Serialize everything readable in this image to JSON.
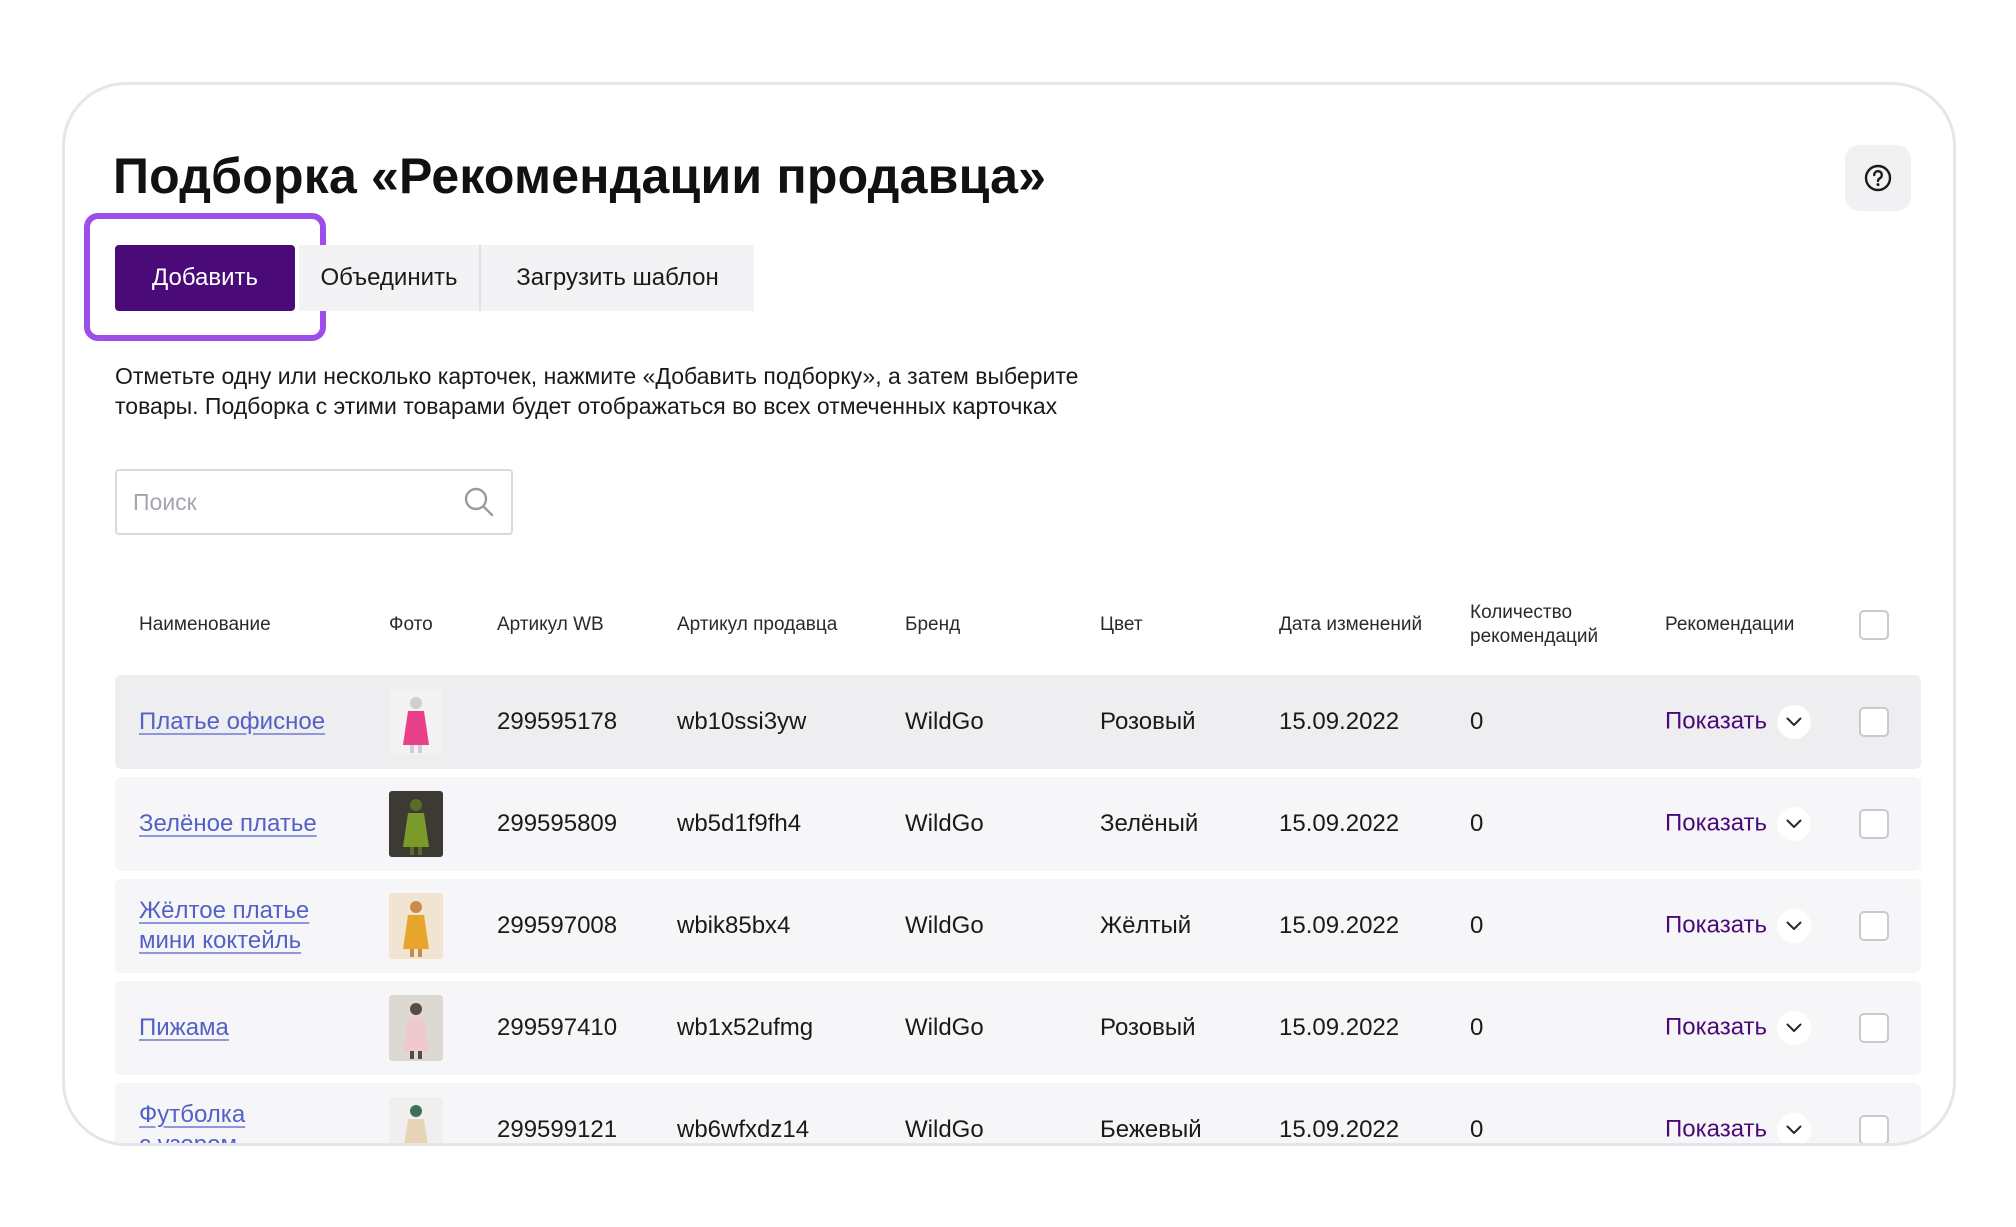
{
  "page": {
    "title": "Подборка «Рекомендации продавца»",
    "help_icon": "question-circle-icon"
  },
  "toolbar": {
    "add_label": "Добавить",
    "merge_label": "Объединить",
    "template_label": "Загрузить шаблон"
  },
  "description": {
    "line1": "Отметьте одну или несколько карточек, нажмите «Добавить подборку», а затем выберите",
    "line2": "товары. Подборка с этими товарами будет отображаться во всех отмеченных карточках"
  },
  "search": {
    "placeholder": "Поиск",
    "icon": "search-icon"
  },
  "table": {
    "columns": {
      "name": "Наименование",
      "photo": "Фото",
      "article_wb": "Артикул WB",
      "article_seller": "Артикул продавца",
      "brand": "Бренд",
      "color": "Цвет",
      "date": "Дата изменений",
      "count_line1": "Количество",
      "count_line2": "рекомендаций",
      "recommendations": "Рекомендации"
    },
    "rows": [
      {
        "name_line1": "Платье офисное",
        "name_line2": "",
        "article_wb": "299595178",
        "article_seller": "wb10ssi3yw",
        "brand": "WildGo",
        "color": "Розовый",
        "date": "15.09.2022",
        "count": "0",
        "action": "Показать",
        "photo_colors": [
          "#f2f2f2",
          "#e8418a",
          "#cfcfcf"
        ]
      },
      {
        "name_line1": "Зелёное платье",
        "name_line2": "",
        "article_wb": "299595809",
        "article_seller": "wb5d1f9fh4",
        "brand": "WildGo",
        "color": "Зелёный",
        "date": "15.09.2022",
        "count": "0",
        "action": "Показать",
        "photo_colors": [
          "#3d3a33",
          "#7a9a2a",
          "#5a6b24"
        ]
      },
      {
        "name_line1": "Жёлтое платье",
        "name_line2": "мини коктейль",
        "article_wb": "299597008",
        "article_seller": "wbik85bx4",
        "brand": "WildGo",
        "color": "Жёлтый",
        "date": "15.09.2022",
        "count": "0",
        "action": "Показать",
        "photo_colors": [
          "#f1e4d2",
          "#e7a52b",
          "#c98a4e"
        ]
      },
      {
        "name_line1": "Пижама",
        "name_line2": "",
        "article_wb": "299597410",
        "article_seller": "wb1x52ufmg",
        "brand": "WildGo",
        "color": "Розовый",
        "date": "15.09.2022",
        "count": "0",
        "action": "Показать",
        "photo_colors": [
          "#dcd8d2",
          "#f0c9cf",
          "#5a4a40"
        ]
      },
      {
        "name_line1": "Футболка",
        "name_line2": "с узором",
        "article_wb": "299599121",
        "article_seller": "wb6wfxdz14",
        "brand": "WildGo",
        "color": "Бежевый",
        "date": "15.09.2022",
        "count": "0",
        "action": "Показать",
        "photo_colors": [
          "#efefef",
          "#e8d5b8",
          "#3f6e5a"
        ]
      }
    ]
  },
  "colors": {
    "primary": "#4a0a78",
    "highlight": "#9d4de8",
    "link": "#5361c7"
  }
}
